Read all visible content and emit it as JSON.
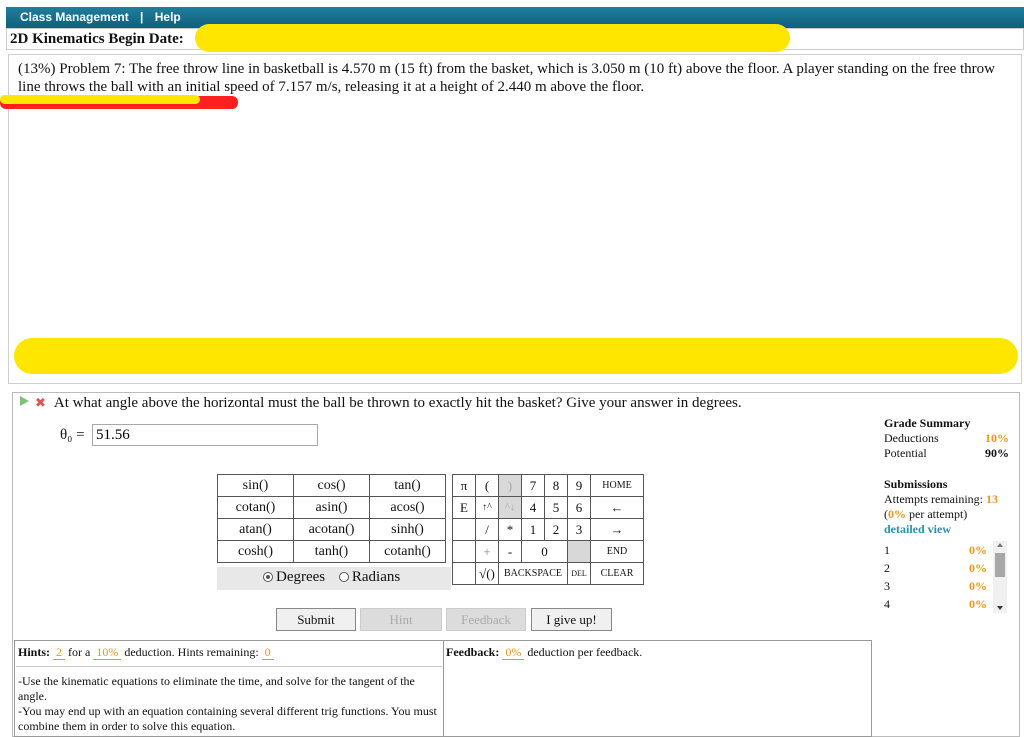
{
  "topbar": {
    "class_management": "Class Management",
    "separator": "|",
    "help": "Help"
  },
  "begin": {
    "label": "2D Kinematics Begin Date:"
  },
  "problem": {
    "text": "(13%) Problem 7:   The free throw line in basketball is 4.570 m (15 ft) from the basket, which is 3.050 m (10 ft) above the floor. A player standing on the free throw line throws the ball with an initial speed of 7.157 m/s, releasing it at a height of 2.440 m above the floor."
  },
  "question": {
    "text": "At what angle above the horizontal must the ball be thrown to exactly hit the basket? Give your answer in degrees."
  },
  "answer": {
    "label": "θ₀ =",
    "value": "51.56"
  },
  "functions": [
    [
      "sin()",
      "cos()",
      "tan()"
    ],
    [
      "cotan()",
      "asin()",
      "acos()"
    ],
    [
      "atan()",
      "acotan()",
      "sinh()"
    ],
    [
      "cosh()",
      "tanh()",
      "cotanh()"
    ]
  ],
  "angle_mode": {
    "degrees": "Degrees",
    "radians": "Radians",
    "selected": "Degrees"
  },
  "keypad": {
    "pi": "π",
    "lparen": "(",
    "rparen": ")",
    "k7": "7",
    "k8": "8",
    "k9": "9",
    "home": "HOME",
    "e": "E",
    "up": "↑^",
    "down": "^↓",
    "k4": "4",
    "k5": "5",
    "k6": "6",
    "left": "←",
    "div": "/",
    "mul": "*",
    "k1": "1",
    "k2": "2",
    "k3": "3",
    "right": "→",
    "plus": "+",
    "minus": "-",
    "k0": "0",
    "end": "END",
    "sqrt": "√()",
    "backspace": "BACKSPACE",
    "del": "DEL",
    "clear": "CLEAR"
  },
  "buttons": {
    "submit": "Submit",
    "hint": "Hint",
    "feedback": "Feedback",
    "give_up": "I give up!"
  },
  "grade": {
    "title": "Grade Summary",
    "deductions_label": "Deductions",
    "deductions_value": "10%",
    "potential_label": "Potential",
    "potential_value": "90%",
    "submissions_title": "Submissions",
    "attempts_label": "Attempts remaining:",
    "attempts_value": "13",
    "per_attempt_value": "0%",
    "per_attempt_label": "per attempt)",
    "detailed": "detailed view",
    "rows": [
      {
        "n": "1",
        "v": "0%"
      },
      {
        "n": "2",
        "v": "0%"
      },
      {
        "n": "3",
        "v": "0%"
      },
      {
        "n": "4",
        "v": "0%"
      }
    ]
  },
  "hints": {
    "label": "Hints:",
    "count": "2",
    "for_a": "for a",
    "pct": "10%",
    "deduction": "deduction. Hints remaining:",
    "remaining": "0",
    "text1": "-Use the kinematic equations to eliminate the time, and solve for the tangent of the angle.",
    "text2": "-You may end up with an equation containing several different trig functions. You must combine them in order to solve this equation."
  },
  "feedback": {
    "label": "Feedback:",
    "pct": "0%",
    "text": "deduction per feedback."
  }
}
